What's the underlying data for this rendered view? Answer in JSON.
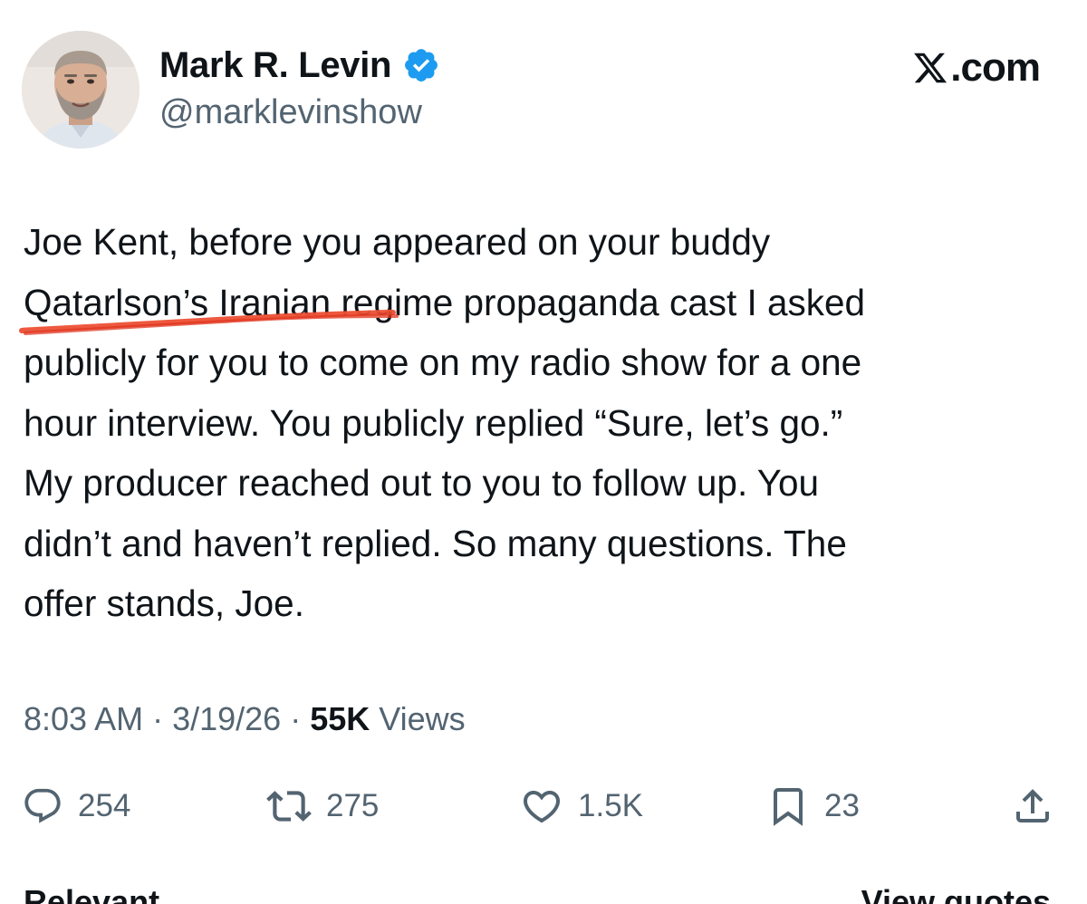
{
  "author": {
    "display_name": "Mark R. Levin",
    "handle": "@marklevinshow",
    "verified": true,
    "avatar_icon": "profile-photo-avatar"
  },
  "watermark": {
    "text": ".com",
    "icon": "x-logo-icon"
  },
  "tweet": {
    "lines": [
      "Joe Kent, before you appeared on your buddy",
      "Qatarlson’s Iranian regime propaganda cast I asked",
      "publicly for you to come on my radio show for a one",
      "hour interview.  You publicly replied “Sure, let’s go.”",
      "My producer reached out to you to follow up. You",
      "didn’t and haven’t replied.  So many questions. The",
      "offer stands, Joe."
    ],
    "annotation": "red-handdrawn-underline"
  },
  "meta": {
    "time": "8:03 AM",
    "separator": " · ",
    "date": "3/19/26",
    "views_count": "55K",
    "views_label": " Views"
  },
  "actions": {
    "replies": "254",
    "reposts": "275",
    "likes": "1.5K",
    "bookmarks": "23"
  },
  "bottom": {
    "sort_tab": "Relevant",
    "view_quotes": "View quotes"
  },
  "colors": {
    "text_primary": "#0f1419",
    "text_secondary": "#536471",
    "verified_blue": "#1d9bf0",
    "annotation_red": "#e8452c"
  }
}
